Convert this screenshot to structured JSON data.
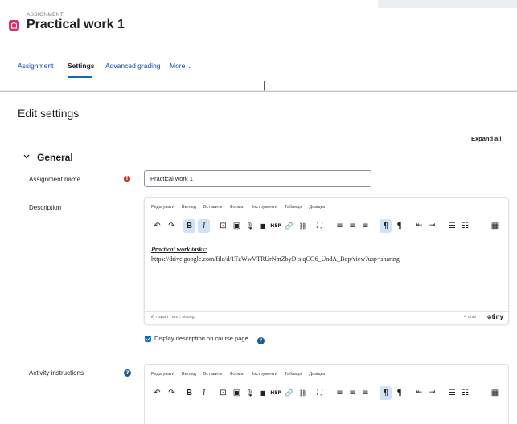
{
  "header": {
    "pre_title": "ASSIGNMENT",
    "title": "Practical work 1"
  },
  "tabs": [
    {
      "label": "Assignment",
      "active": false
    },
    {
      "label": "Settings",
      "active": true
    },
    {
      "label": "Advanced grading",
      "active": false
    },
    {
      "label": "More",
      "active": false
    }
  ],
  "more_chevron": "⌄",
  "main": {
    "title": "Edit settings",
    "expand_all": "Expand all"
  },
  "general": {
    "label": "General"
  },
  "fields": {
    "assignment_name": {
      "label": "Assignment name",
      "value": "Practical work 1"
    },
    "description": {
      "label": "Description"
    },
    "activity_instructions": {
      "label": "Activity instructions"
    }
  },
  "editor_menu": [
    "Редагувати",
    "Вигляд",
    "Вставити",
    "Формат",
    "Інструменти",
    "Таблиця",
    "Довідка"
  ],
  "editor_toolbar_icons": {
    "undo": "↶",
    "redo": "↷",
    "bold": "B",
    "italic": "I",
    "image": "⊡",
    "media": "▣",
    "audio": "🎙",
    "video": "■",
    "h5p": "H5P",
    "link": "🔗",
    "unlink": "⛓",
    "fullscreen": "⛶",
    "align_left": "≡",
    "align_center": "≡",
    "align_right": "≡",
    "ltr": "¶",
    "rtl": "¶",
    "indent_less": "⇤",
    "indent_more": "⇥",
    "bullet_list": "☰",
    "numbered_list": "☷",
    "more": "▦"
  },
  "description_content": {
    "heading": "Practical work tasks:",
    "link": "https://drive.google.com/file/d/1TzWwVTRUrNmZbyD-siqCO6_UndA_Bop/view?usp=sharing"
  },
  "editor_status": {
    "path": "h6 › span › em › strong",
    "word_count": "4 слів",
    "brand": "tiny"
  },
  "display_description": {
    "label": "Display description on course page",
    "checked": true
  },
  "colors": {
    "link": "#0f47ad",
    "accent": "#0f6cbf",
    "required": "#ca3120",
    "help": "#1e5b96",
    "activity_icon": "#d6336c",
    "active_button": "#cfe3f6"
  }
}
